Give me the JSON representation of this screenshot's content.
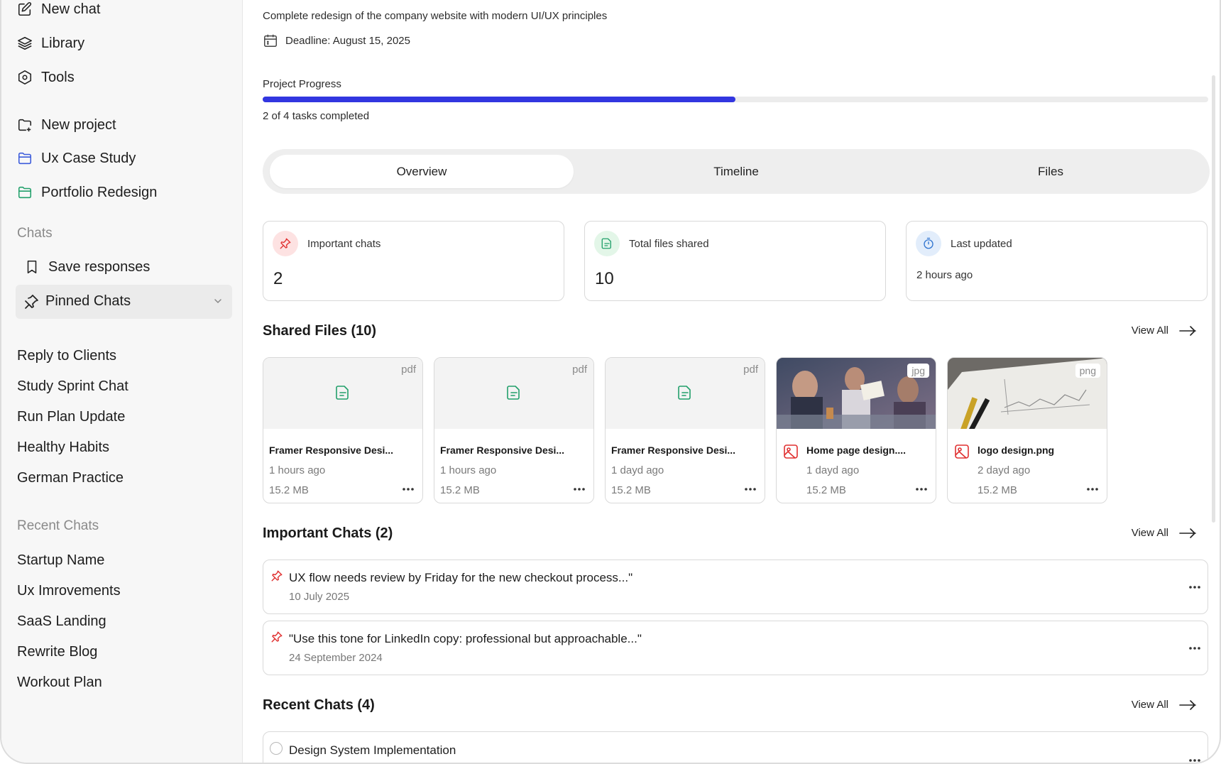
{
  "sidebar": {
    "top_items": [
      {
        "label": "New chat",
        "icon": "edit-icon"
      },
      {
        "label": "Library",
        "icon": "layers-icon"
      },
      {
        "label": "Tools",
        "icon": "hexagon-icon"
      }
    ],
    "project_items": [
      {
        "label": "New project",
        "icon": "folder-plus-icon",
        "color": "#1d1d1d"
      },
      {
        "label": "Ux Case Study",
        "icon": "folder-icon",
        "color": "#3b5bdb"
      },
      {
        "label": "Portfolio Redesign",
        "icon": "folder-icon",
        "color": "#22a06b"
      }
    ],
    "chats_heading": "Chats",
    "save_responses": "Save responses",
    "pinned_chats": "Pinned Chats",
    "pinned_list": [
      "Reply to Clients",
      "Study Sprint Chat",
      "Run Plan Update",
      "Healthy Habits",
      "German Practice"
    ],
    "recent_heading": "Recent Chats",
    "recent_list": [
      "Startup Name",
      "Ux Imrovements",
      "SaaS Landing",
      "Rewrite Blog",
      "Workout Plan"
    ]
  },
  "project": {
    "description": "Complete redesign of the company website with modern UI/UX principles",
    "deadline": "Deadline: August 15, 2025",
    "progress_label": "Project Progress",
    "progress_fraction": 0.5,
    "progress_text": "2 of 4 tasks completed",
    "accent_color": "#3236e0"
  },
  "tabs": [
    "Overview",
    "Timeline",
    "Files"
  ],
  "stats": [
    {
      "title": "Important chats",
      "value": "2",
      "icon": "pin-icon",
      "icon_bg": "#fde2e2",
      "icon_color": "#e03131"
    },
    {
      "title": "Total files shared",
      "value": "10",
      "icon": "file-icon",
      "icon_bg": "#e3f6e8",
      "icon_color": "#22a06b"
    },
    {
      "title": "Last updated",
      "value": "2 hours ago",
      "icon": "timer-icon",
      "icon_bg": "#e2edfb",
      "icon_color": "#2f74d0"
    }
  ],
  "shared_files": {
    "title": "Shared Files (10)",
    "view_all": "View All",
    "files": [
      {
        "ext": "pdf",
        "name": "Framer Responsive Desi...",
        "time": "1 hours ago",
        "size": "15.2 MB"
      },
      {
        "ext": "pdf",
        "name": "Framer Responsive Desi...",
        "time": "1 hours ago",
        "size": "15.2 MB"
      },
      {
        "ext": "pdf",
        "name": "Framer Responsive Desi...",
        "time": "1 dayd ago",
        "size": "15.2 MB"
      },
      {
        "ext": "jpg",
        "name": "Home page design....",
        "time": "1 dayd ago",
        "size": "15.2 MB"
      },
      {
        "ext": "png",
        "name": "logo design.png",
        "time": "2 dayd ago",
        "size": "15.2 MB"
      }
    ]
  },
  "important_chats": {
    "title": "Important Chats (2)",
    "view_all": "View All",
    "items": [
      {
        "text": "UX flow needs review by Friday for the new checkout process...\"",
        "date": "10 July 2025"
      },
      {
        "text": "\"Use this tone for LinkedIn copy: professional but approachable...\"",
        "date": "24 September 2024"
      }
    ]
  },
  "recent_chats": {
    "title": "Recent Chats (4)",
    "view_all": "View All",
    "items": [
      {
        "text": "Design System Implementation"
      }
    ]
  }
}
